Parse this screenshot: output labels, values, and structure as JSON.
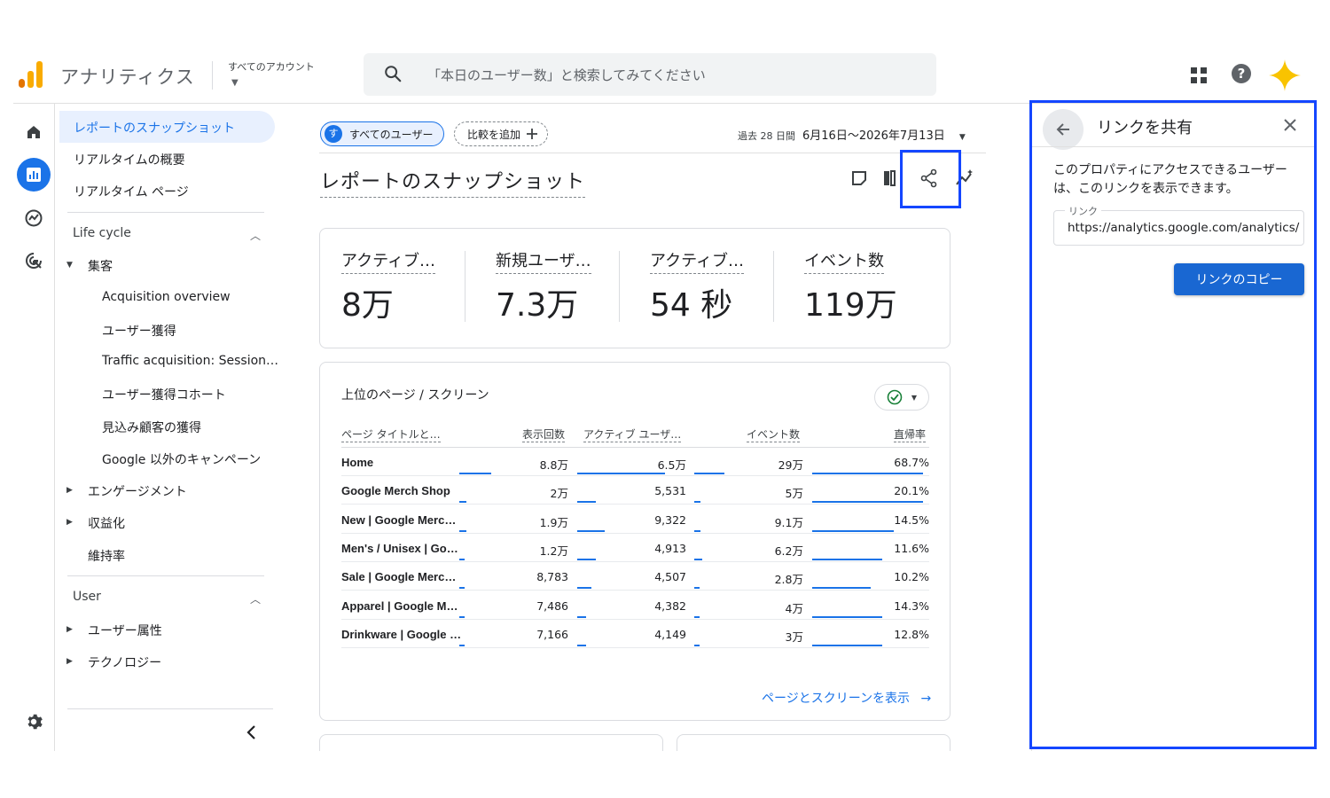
{
  "header": {
    "app_name": "アナリティクス",
    "account_label": "すべてのアカウント",
    "search_placeholder": "「本日のユーザー数」と検索してみてください",
    "icons": [
      "apps-icon",
      "help-icon",
      "sparkle-icon"
    ]
  },
  "colors": {
    "accent": "#1a73e8",
    "highlight": "#1446ff",
    "logo_orange": "#f9ab00",
    "logo_dark": "#e37400"
  },
  "nav": {
    "items_top": [
      {
        "label": "レポートのスナップショット",
        "active": true
      },
      {
        "label": "リアルタイムの概要"
      },
      {
        "label": "リアルタイム ページ"
      }
    ],
    "lifecycle": {
      "title": "Life cycle",
      "acquisition": "集客",
      "acquisition_items": [
        "Acquisition overview",
        "ユーザー獲得",
        "Traffic acquisition: Session…",
        "ユーザー獲得コホート",
        "見込み顧客の獲得",
        "Google 以外のキャンペーン"
      ],
      "engagement": "エンゲージメント",
      "monetization": "収益化",
      "retention": "維持率"
    },
    "user": {
      "title": "User",
      "demographics": "ユーザー属性",
      "technology": "テクノロジー"
    }
  },
  "main": {
    "chip_users": "すべてのユーザー",
    "chip_avatar": "す",
    "chip_compare": "比較を追加",
    "date_prefix": "過去 28 日間",
    "date_range": "6月16日〜2026年7月13日",
    "title": "レポートのスナップショット",
    "metrics": [
      {
        "label": "アクティブ…",
        "value": "8万"
      },
      {
        "label": "新規ユーザ…",
        "value": "7.3万"
      },
      {
        "label": "アクティブ…",
        "value": "54 秒"
      },
      {
        "label": "イベント数",
        "value": "119万"
      }
    ],
    "table": {
      "title": "上位のページ / スクリーン",
      "headers": [
        "ページ タイトルと…",
        "表示回数",
        "アクティブ ユーザ…",
        "イベント数",
        "直帰率"
      ],
      "rows": [
        {
          "name": "Home",
          "views": "8.8万",
          "users": "6.5万",
          "events": "29万",
          "bounce": "68.7%"
        },
        {
          "name": "Google Merch Shop",
          "views": "2万",
          "users": "5,531",
          "events": "5万",
          "bounce": "20.1%"
        },
        {
          "name": "New | Google Merc…",
          "views": "1.9万",
          "users": "9,322",
          "events": "9.1万",
          "bounce": "14.5%"
        },
        {
          "name": "Men's / Unisex | Go…",
          "views": "1.2万",
          "users": "4,913",
          "events": "6.2万",
          "bounce": "11.6%"
        },
        {
          "name": "Sale | Google Merc…",
          "views": "8,783",
          "users": "4,507",
          "events": "2.8万",
          "bounce": "10.2%"
        },
        {
          "name": "Apparel | Google M…",
          "views": "7,486",
          "users": "4,382",
          "events": "4万",
          "bounce": "14.3%"
        },
        {
          "name": "Drinkware | Google …",
          "views": "7,166",
          "users": "4,149",
          "events": "3万",
          "bounce": "12.8%"
        }
      ],
      "view_link": "ページとスクリーンを表示"
    }
  },
  "panel": {
    "title": "リンクを共有",
    "description": "このプロパティにアクセスできるユーザーは、このリンクを表示できます。",
    "link_label": "リンク",
    "link_value": "https://analytics.google.com/analytics/",
    "copy_button": "リンクのコピー"
  }
}
